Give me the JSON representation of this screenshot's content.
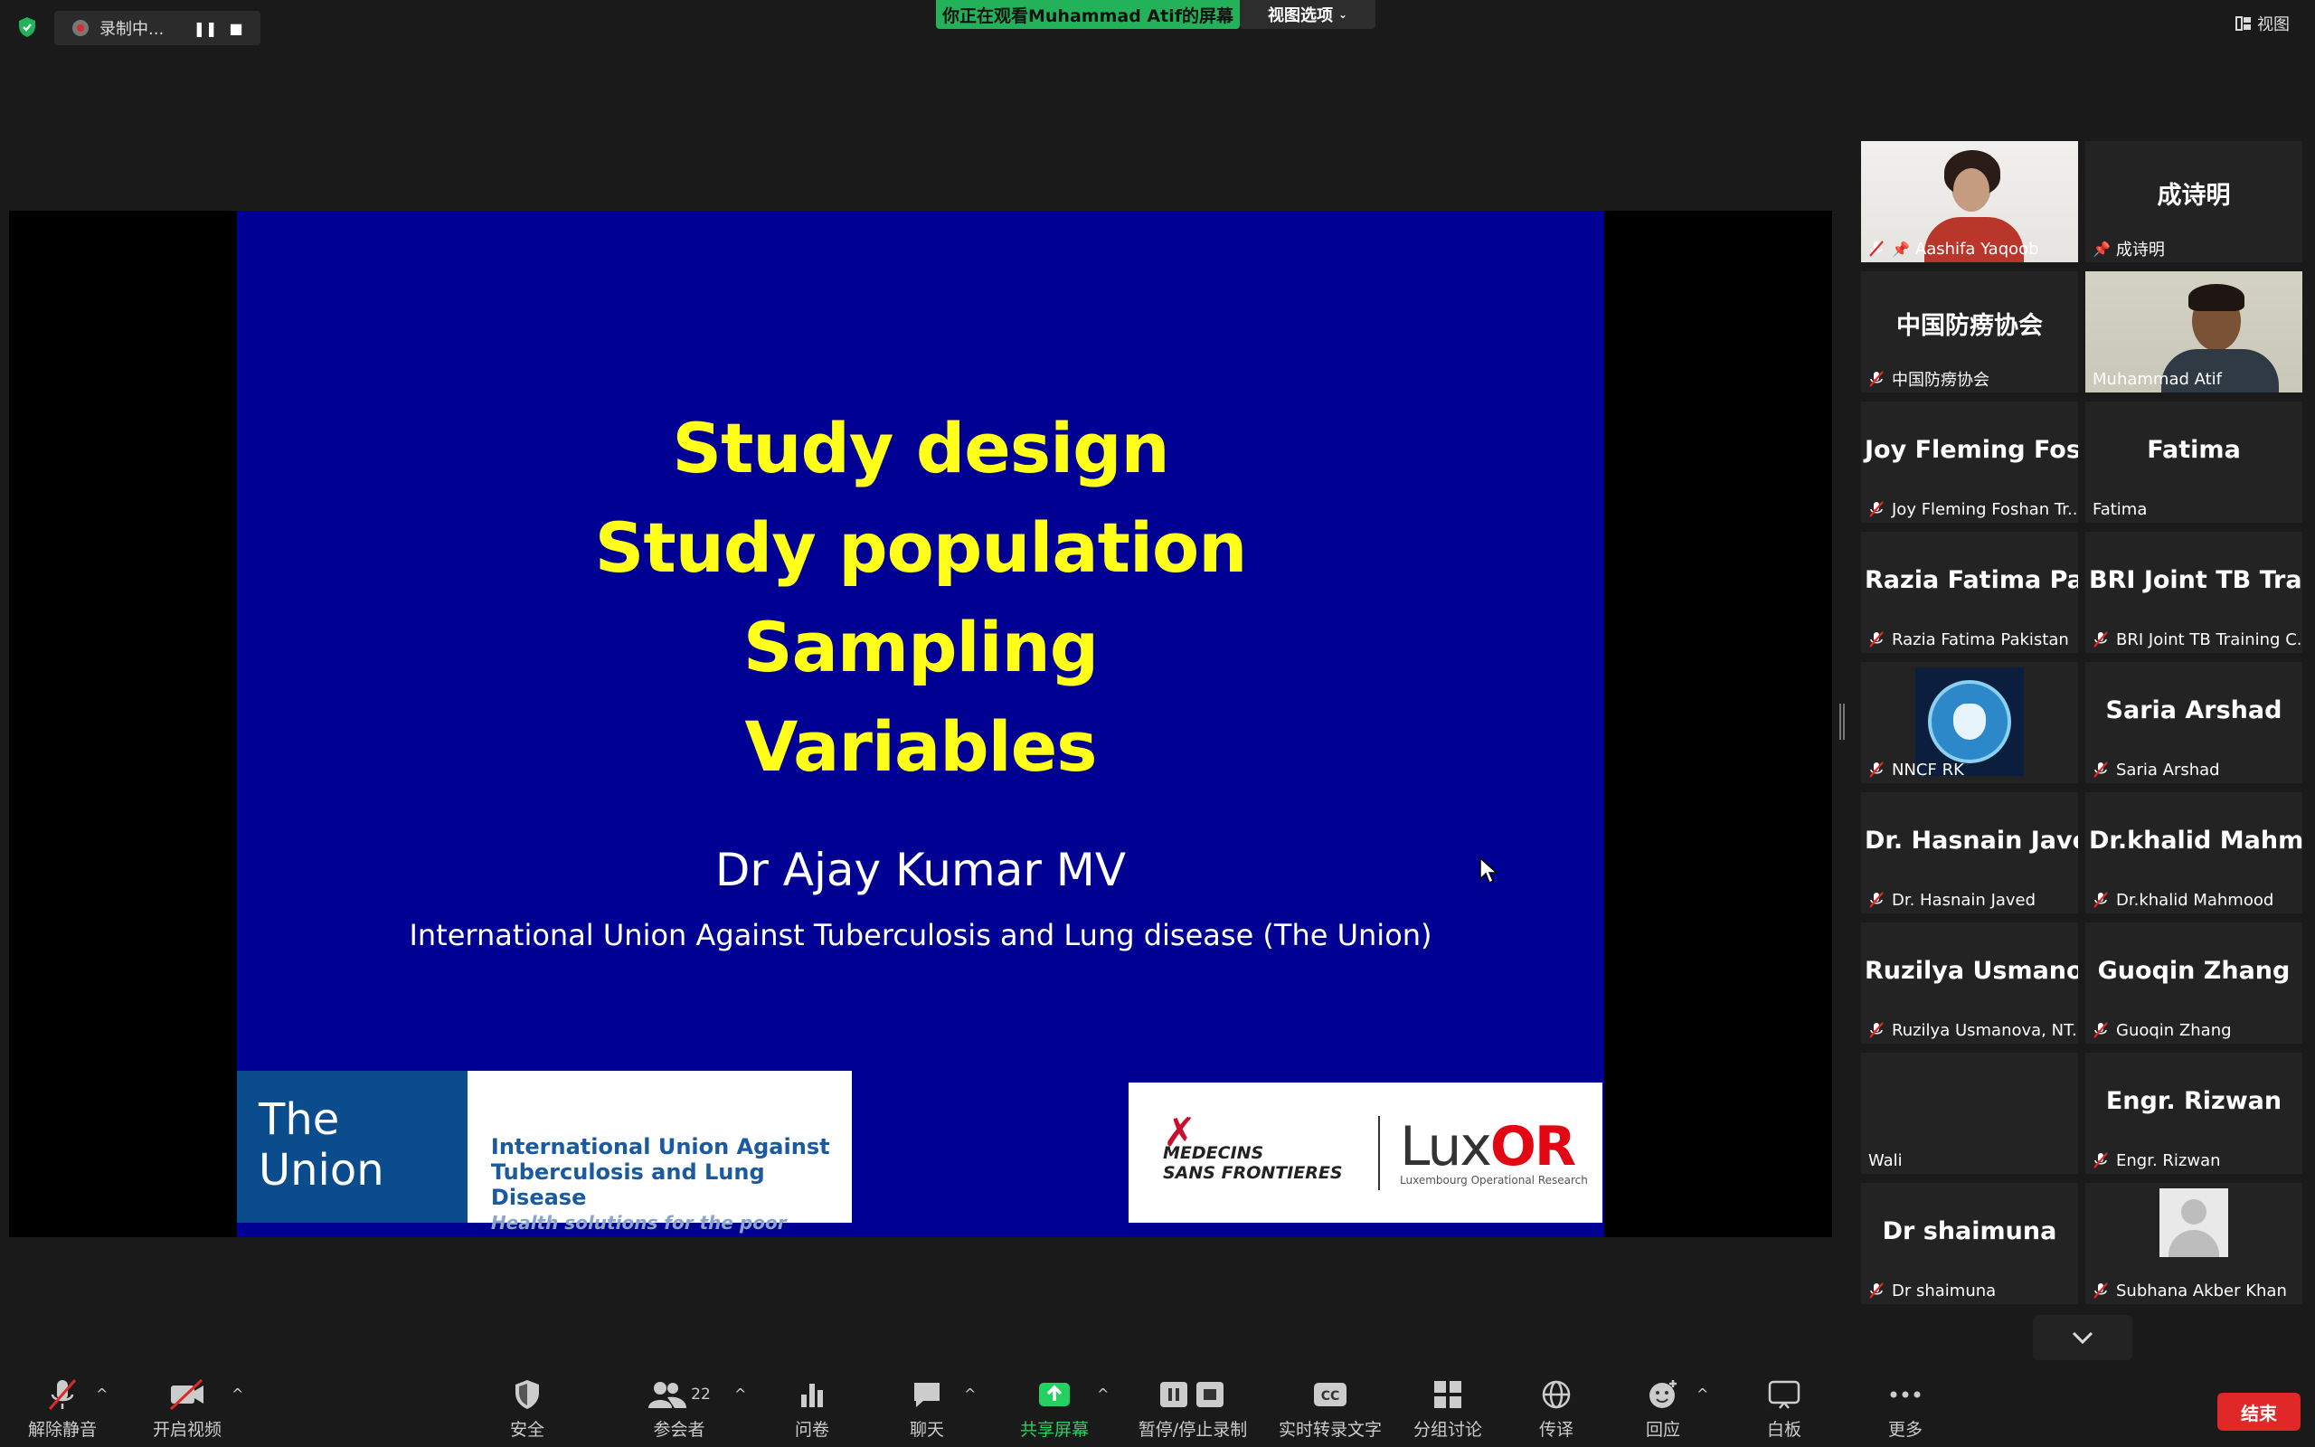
{
  "top": {
    "recording_label": "录制中...",
    "share_banner": "你正在观看Muhammad Atif的屏幕",
    "view_options": "视图选项",
    "view": "视图"
  },
  "slide": {
    "titles": [
      "Study design",
      "Study population",
      "Sampling",
      "Variables"
    ],
    "author": "Dr Ajay Kumar MV",
    "org": "International Union Against Tuberculosis and Lung disease (The Union)",
    "union_name": "The Union",
    "union_full_1": "International Union Against",
    "union_full_2": "Tuberculosis and Lung Disease",
    "union_tagline": "Health solutions for the poor",
    "msf_1": "MEDECINS",
    "msf_2": "SANS FRONTIERES",
    "lux_main": "Lux",
    "lux_accent": "OR",
    "lux_sub": "Luxembourg Operational Research"
  },
  "participants": [
    {
      "display": "",
      "name": "Aashifa Yaqoob"
    },
    {
      "display": "成诗明",
      "name": "成诗明"
    },
    {
      "display": "中国防痨协会",
      "name": "中国防痨协会"
    },
    {
      "display": "",
      "name": "Muhammad Atif"
    },
    {
      "display": "Joy Fleming Fos...",
      "name": "Joy Fleming Foshan Tr..."
    },
    {
      "display": "Fatima",
      "name": "Fatima"
    },
    {
      "display": "Razia Fatima Pa...",
      "name": "Razia Fatima Pakistan"
    },
    {
      "display": "BRI Joint TB Tra...",
      "name": "BRI Joint TB Training C..."
    },
    {
      "display": "",
      "name": "NNCF RK"
    },
    {
      "display": "Saria Arshad",
      "name": "Saria Arshad"
    },
    {
      "display": "Dr. Hasnain Javed",
      "name": "Dr. Hasnain Javed"
    },
    {
      "display": "Dr.khalid Mahm...",
      "name": "Dr.khalid Mahmood"
    },
    {
      "display": "Ruzilya Usmano...",
      "name": "Ruzilya Usmanova, NT..."
    },
    {
      "display": "Guoqin Zhang",
      "name": "Guoqin Zhang"
    },
    {
      "display": "",
      "name": "Wali"
    },
    {
      "display": "Engr. Rizwan",
      "name": "Engr. Rizwan"
    },
    {
      "display": "Dr shaimuna",
      "name": "Dr shaimuna"
    },
    {
      "display": "",
      "name": "Subhana Akber Khan"
    }
  ],
  "toolbar": {
    "unmute": "解除静音",
    "start_video": "开启视频",
    "security": "安全",
    "participants": "参会者",
    "participant_count": "22",
    "polls": "问卷",
    "chat": "聊天",
    "share_screen": "共享屏幕",
    "pause_stop_recording": "暂停/停止录制",
    "live_transcript": "实时转录文字",
    "breakout": "分组讨论",
    "interpretation": "传译",
    "reactions": "回应",
    "whiteboard": "白板",
    "more": "更多",
    "end": "结束",
    "cc": "CC"
  },
  "colors": {
    "background": "#1a1a1a",
    "tile": "#232323",
    "slide_bg": "#000092",
    "slide_title": "#ffff1a",
    "share_green": "#23b25a",
    "end_red": "#e02828",
    "active_speaker": "#c8e36b"
  }
}
